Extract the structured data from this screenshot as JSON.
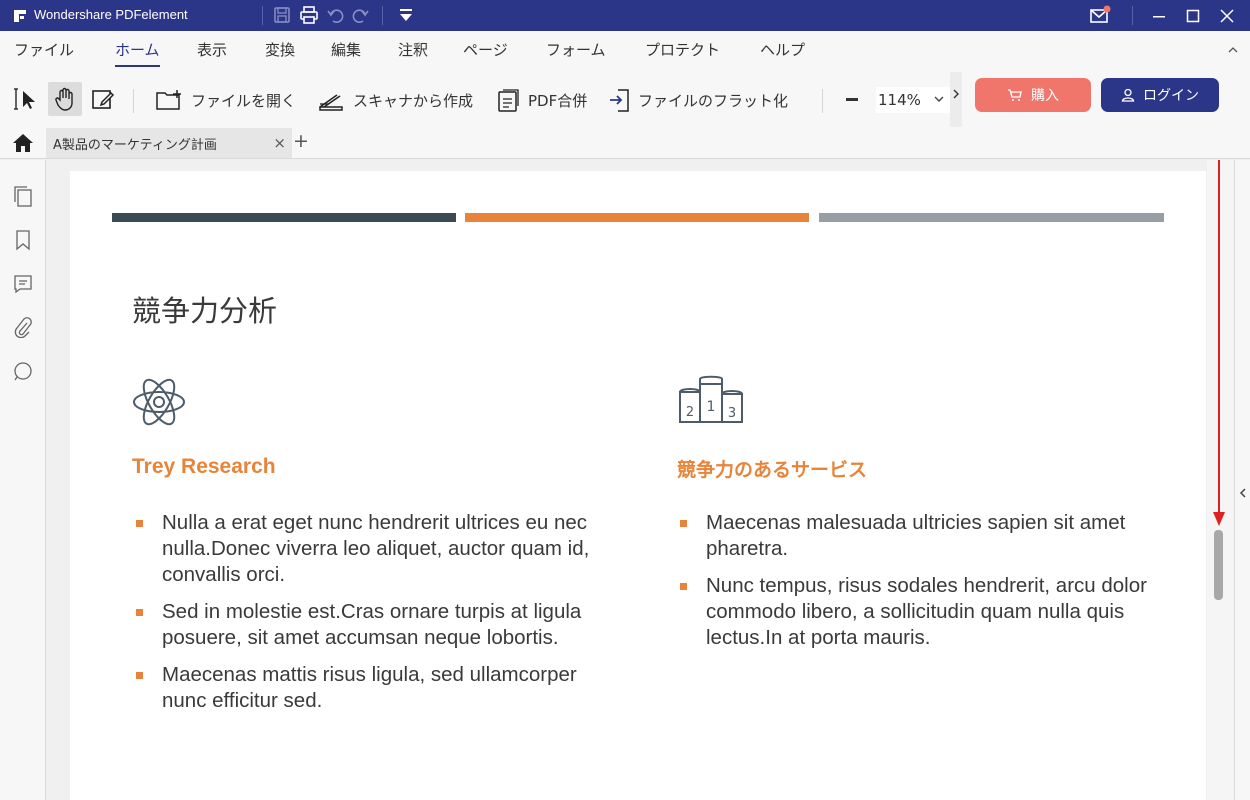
{
  "app": {
    "name": "Wondershare PDFelement",
    "brand_color": "#2c3689"
  },
  "menu": {
    "items": [
      "ファイル",
      "ホーム",
      "表示",
      "変換",
      "編集",
      "注釈",
      "ページ",
      "フォーム",
      "プロテクト",
      "ヘルプ"
    ],
    "active": "ホーム"
  },
  "toolbar": {
    "open_file": "ファイルを開く",
    "scan_create": "スキャナから作成",
    "pdf_merge": "PDF合併",
    "flatten": "ファイルのフラット化",
    "zoom": "114%",
    "buy": "購入",
    "login": "ログイン",
    "buy_color": "#f0766b"
  },
  "tabs": {
    "doc_title": "A製品のマーケティング計画",
    "close_glyph": "×",
    "add_glyph": "+"
  },
  "document": {
    "heading": "競争力分析",
    "bar_colors": [
      "#3c4a54",
      "#e8843a",
      "#969fa6"
    ],
    "accent": "#e8843a",
    "left": {
      "icon": "atom-icon",
      "title": "Trey Research",
      "bullets": [
        "Nulla a erat eget nunc hendrerit ultrices eu nec nulla.Donec viverra leo aliquet, auctor quam id, convallis orci.",
        "Sed in molestie est.Cras ornare turpis at ligula posuere, sit amet accumsan neque lobortis.",
        "Maecenas mattis risus ligula, sed ullamcorper nunc efficitur sed."
      ]
    },
    "right": {
      "icon": "podium-icon",
      "title": "競争力のあるサービス",
      "bullets": [
        "Maecenas malesuada ultricies sapien sit amet pharetra.",
        "Nunc tempus, risus sodales hendrerit, arcu dolor commodo libero, a sollicitudin quam nulla quis lectus.In at porta mauris."
      ]
    },
    "podium_numbers": [
      "2",
      "1",
      "3"
    ]
  },
  "annotation": {
    "arrow_color": "#e02020"
  }
}
